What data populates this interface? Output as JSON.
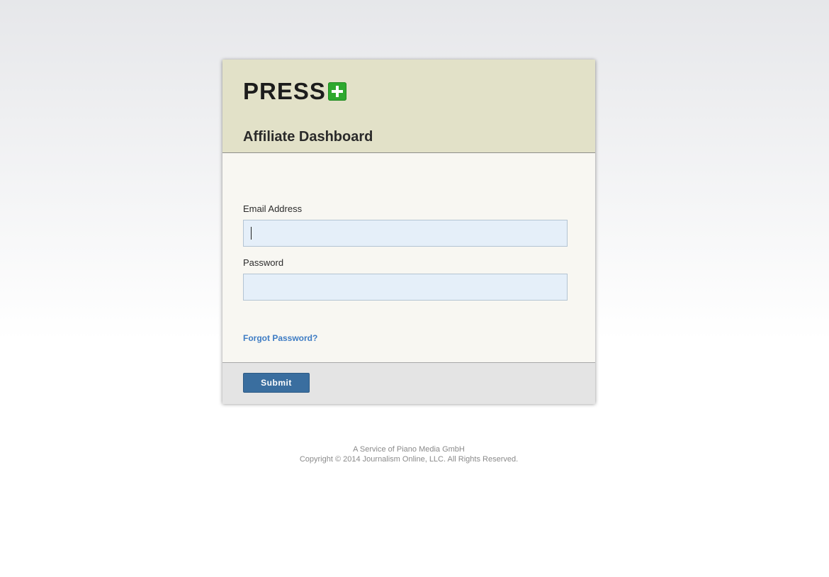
{
  "header": {
    "logo_text": "PRESS",
    "logo_icon": "plus-icon",
    "title": "Affiliate Dashboard"
  },
  "form": {
    "email_label": "Email Address",
    "email_value": "",
    "password_label": "Password",
    "password_value": "",
    "forgot_link": "Forgot Password?",
    "submit_label": "Submit"
  },
  "footer": {
    "service_text": "A Service of Piano Media GmbH",
    "copyright_text": "Copyright © 2014 Journalism Online, LLC. All Rights Reserved."
  },
  "colors": {
    "header_bg": "#e2e1c8",
    "body_bg": "#f8f7f2",
    "input_bg": "#e5eff9",
    "link": "#3e7cc4",
    "button": "#3a6e9f",
    "logo_plus": "#2ea82e"
  }
}
